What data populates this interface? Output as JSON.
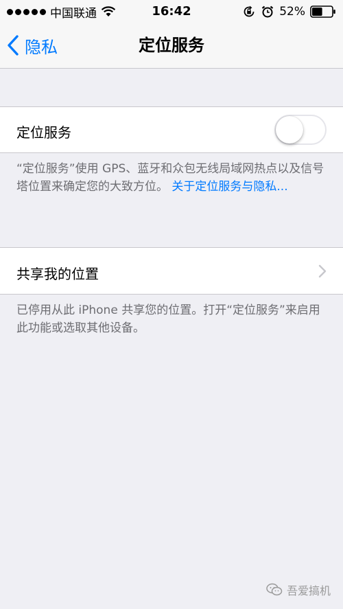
{
  "status_bar": {
    "carrier": "中国联通",
    "time": "16:42",
    "battery": "52%",
    "icons": [
      "signal-dots-icon",
      "wifi-icon",
      "orientation-lock-icon",
      "alarm-icon",
      "battery-icon"
    ]
  },
  "nav": {
    "back_label": "隐私",
    "title": "定位服务"
  },
  "location_services": {
    "label": "定位服务",
    "enabled": false,
    "footer_text": "“定位服务”使用 GPS、蓝牙和众包无线局域网热点以及信号塔位置来确定您的大致方位。",
    "footer_link": "关于定位服务与隐私..."
  },
  "share_location": {
    "label": "共享我的位置",
    "footer_text": "已停用从此 iPhone 共享您的位置。打开“定位服务”来启用此功能或选取其他设备。"
  },
  "watermark": {
    "text": "吾爱搞机"
  },
  "colors": {
    "accent": "#007aff",
    "background": "#efeff4",
    "separator": "#c8c7cc",
    "footer_text": "#6d6d72"
  }
}
